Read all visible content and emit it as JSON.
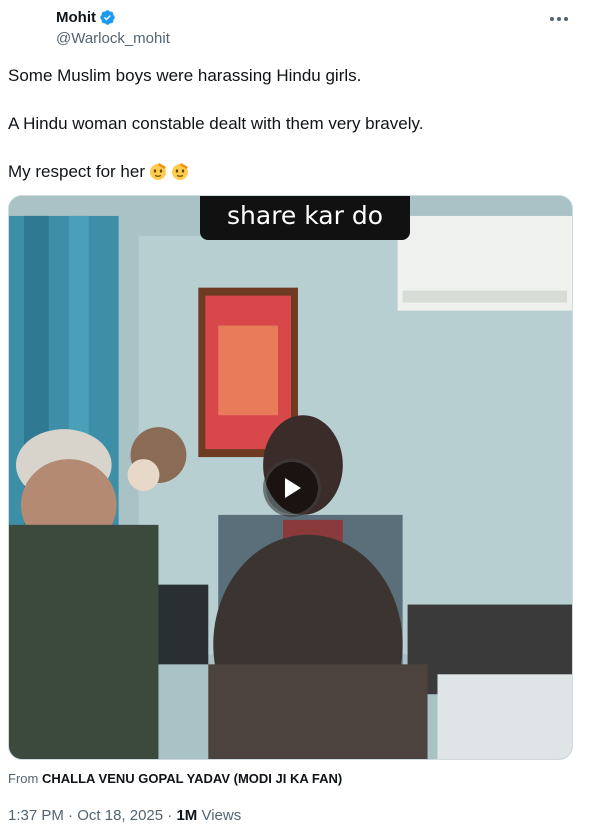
{
  "author": {
    "name": "Mohit",
    "handle": "@Warlock_mohit"
  },
  "tweet": {
    "line1": "Some Muslim boys were harassing Hindu girls.",
    "line2": "A Hindu woman constable dealt with them very bravely.",
    "line3": "My respect for her",
    "emojis": [
      "saluting-face-icon",
      "saluting-face-icon"
    ]
  },
  "media": {
    "caption_overlay": "share kar do"
  },
  "source": {
    "prefix": "From",
    "name": "CHALLA VENU GOPAL YADAV (MODI JI KA FAN)"
  },
  "meta": {
    "time": "1:37 PM",
    "sep1": "·",
    "date": "Oct 18, 2025",
    "sep2": "·",
    "views_count": "1M",
    "views_label": "Views"
  },
  "colors": {
    "verified": "#1d9bf0",
    "secondary_text": "#536471",
    "primary_text": "#0f1419"
  }
}
